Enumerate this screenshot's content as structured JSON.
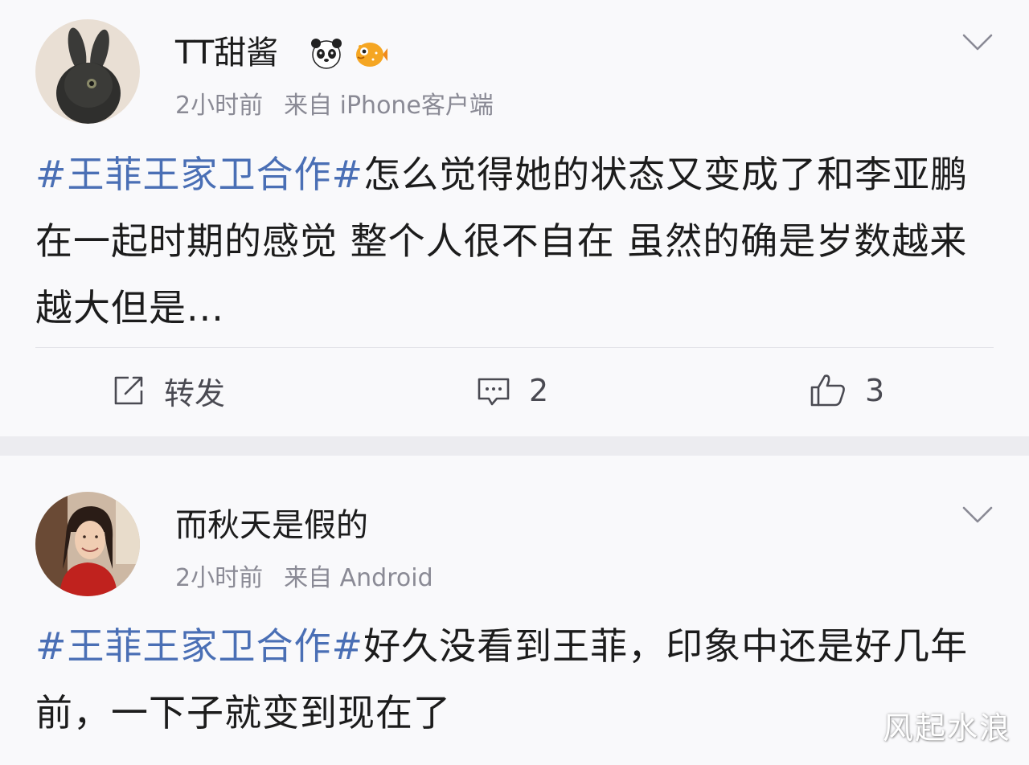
{
  "posts": [
    {
      "username": "TT甜酱",
      "badge_icons": [
        "panda-emoji",
        "pufferfish-emoji"
      ],
      "time": "2小时前",
      "source": "来自 iPhone客户端",
      "hashtag": "#王菲王家卫合作#",
      "body": "怎么觉得她的状态又变成了和李亚鹏在一起时期的感觉 整个人很不自在 虽然的确是岁数越来越大但是...",
      "actions": {
        "repost_label": "转发",
        "comment_count": "2",
        "like_count": "3"
      }
    },
    {
      "username": "而秋天是假的",
      "time": "2小时前",
      "source": "来自 Android",
      "hashtag": "#王菲王家卫合作#",
      "body": "好久没看到王菲，印象中还是好几年前，一下子就变到现在了"
    }
  ],
  "watermark": "风起水浪",
  "colors": {
    "hashtag": "#4a6fb5",
    "meta_text": "#8a8a95",
    "card_bg": "#f9f9fb",
    "separator_bg": "#ececf0"
  },
  "icons": {
    "more": "chevron-down-icon",
    "repost": "share-edit-icon",
    "comment": "comment-bubble-icon",
    "like": "thumbs-up-icon"
  }
}
